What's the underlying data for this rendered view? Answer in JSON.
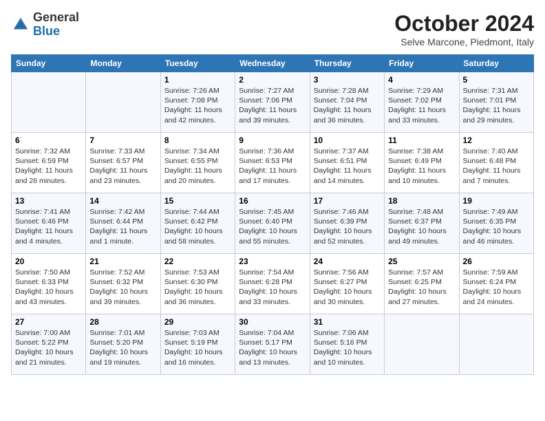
{
  "header": {
    "logo_general": "General",
    "logo_blue": "Blue",
    "month": "October 2024",
    "location": "Selve Marcone, Piedmont, Italy"
  },
  "weekdays": [
    "Sunday",
    "Monday",
    "Tuesday",
    "Wednesday",
    "Thursday",
    "Friday",
    "Saturday"
  ],
  "weeks": [
    [
      {
        "day": "",
        "info": ""
      },
      {
        "day": "",
        "info": ""
      },
      {
        "day": "1",
        "info": "Sunrise: 7:26 AM\nSunset: 7:08 PM\nDaylight: 11 hours and 42 minutes."
      },
      {
        "day": "2",
        "info": "Sunrise: 7:27 AM\nSunset: 7:06 PM\nDaylight: 11 hours and 39 minutes."
      },
      {
        "day": "3",
        "info": "Sunrise: 7:28 AM\nSunset: 7:04 PM\nDaylight: 11 hours and 36 minutes."
      },
      {
        "day": "4",
        "info": "Sunrise: 7:29 AM\nSunset: 7:02 PM\nDaylight: 11 hours and 33 minutes."
      },
      {
        "day": "5",
        "info": "Sunrise: 7:31 AM\nSunset: 7:01 PM\nDaylight: 11 hours and 29 minutes."
      }
    ],
    [
      {
        "day": "6",
        "info": "Sunrise: 7:32 AM\nSunset: 6:59 PM\nDaylight: 11 hours and 26 minutes."
      },
      {
        "day": "7",
        "info": "Sunrise: 7:33 AM\nSunset: 6:57 PM\nDaylight: 11 hours and 23 minutes."
      },
      {
        "day": "8",
        "info": "Sunrise: 7:34 AM\nSunset: 6:55 PM\nDaylight: 11 hours and 20 minutes."
      },
      {
        "day": "9",
        "info": "Sunrise: 7:36 AM\nSunset: 6:53 PM\nDaylight: 11 hours and 17 minutes."
      },
      {
        "day": "10",
        "info": "Sunrise: 7:37 AM\nSunset: 6:51 PM\nDaylight: 11 hours and 14 minutes."
      },
      {
        "day": "11",
        "info": "Sunrise: 7:38 AM\nSunset: 6:49 PM\nDaylight: 11 hours and 10 minutes."
      },
      {
        "day": "12",
        "info": "Sunrise: 7:40 AM\nSunset: 6:48 PM\nDaylight: 11 hours and 7 minutes."
      }
    ],
    [
      {
        "day": "13",
        "info": "Sunrise: 7:41 AM\nSunset: 6:46 PM\nDaylight: 11 hours and 4 minutes."
      },
      {
        "day": "14",
        "info": "Sunrise: 7:42 AM\nSunset: 6:44 PM\nDaylight: 11 hours and 1 minute."
      },
      {
        "day": "15",
        "info": "Sunrise: 7:44 AM\nSunset: 6:42 PM\nDaylight: 10 hours and 58 minutes."
      },
      {
        "day": "16",
        "info": "Sunrise: 7:45 AM\nSunset: 6:40 PM\nDaylight: 10 hours and 55 minutes."
      },
      {
        "day": "17",
        "info": "Sunrise: 7:46 AM\nSunset: 6:39 PM\nDaylight: 10 hours and 52 minutes."
      },
      {
        "day": "18",
        "info": "Sunrise: 7:48 AM\nSunset: 6:37 PM\nDaylight: 10 hours and 49 minutes."
      },
      {
        "day": "19",
        "info": "Sunrise: 7:49 AM\nSunset: 6:35 PM\nDaylight: 10 hours and 46 minutes."
      }
    ],
    [
      {
        "day": "20",
        "info": "Sunrise: 7:50 AM\nSunset: 6:33 PM\nDaylight: 10 hours and 43 minutes."
      },
      {
        "day": "21",
        "info": "Sunrise: 7:52 AM\nSunset: 6:32 PM\nDaylight: 10 hours and 39 minutes."
      },
      {
        "day": "22",
        "info": "Sunrise: 7:53 AM\nSunset: 6:30 PM\nDaylight: 10 hours and 36 minutes."
      },
      {
        "day": "23",
        "info": "Sunrise: 7:54 AM\nSunset: 6:28 PM\nDaylight: 10 hours and 33 minutes."
      },
      {
        "day": "24",
        "info": "Sunrise: 7:56 AM\nSunset: 6:27 PM\nDaylight: 10 hours and 30 minutes."
      },
      {
        "day": "25",
        "info": "Sunrise: 7:57 AM\nSunset: 6:25 PM\nDaylight: 10 hours and 27 minutes."
      },
      {
        "day": "26",
        "info": "Sunrise: 7:59 AM\nSunset: 6:24 PM\nDaylight: 10 hours and 24 minutes."
      }
    ],
    [
      {
        "day": "27",
        "info": "Sunrise: 7:00 AM\nSunset: 5:22 PM\nDaylight: 10 hours and 21 minutes."
      },
      {
        "day": "28",
        "info": "Sunrise: 7:01 AM\nSunset: 5:20 PM\nDaylight: 10 hours and 19 minutes."
      },
      {
        "day": "29",
        "info": "Sunrise: 7:03 AM\nSunset: 5:19 PM\nDaylight: 10 hours and 16 minutes."
      },
      {
        "day": "30",
        "info": "Sunrise: 7:04 AM\nSunset: 5:17 PM\nDaylight: 10 hours and 13 minutes."
      },
      {
        "day": "31",
        "info": "Sunrise: 7:06 AM\nSunset: 5:16 PM\nDaylight: 10 hours and 10 minutes."
      },
      {
        "day": "",
        "info": ""
      },
      {
        "day": "",
        "info": ""
      }
    ]
  ]
}
